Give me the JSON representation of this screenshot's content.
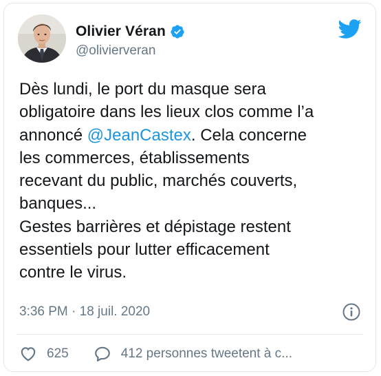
{
  "tweet": {
    "author": {
      "display_name": "Olivier Véran",
      "handle": "@olivierveran",
      "verified": true,
      "avatar_icon": "person-portrait-icon"
    },
    "brand_icon": "twitter-bird-icon",
    "text": {
      "part1": "Dès lundi, le port du masque sera\nobligatoire dans les lieux clos comme l’a\nannoncé ",
      "mention": "@JeanCastex",
      "part2": ". Cela concerne\nles commerces, établissements\nrecevant du public, marchés couverts,\nbanques...\nGestes barrières et dépistage restent\nessentiels pour lutter efficacement\ncontre le virus."
    },
    "timestamp": "3:36 PM · 18 juil. 2020",
    "info_icon": "info-icon",
    "likes": {
      "icon": "heart-icon",
      "count": "625"
    },
    "retweets": {
      "icon": "speech-bubble-icon",
      "label": "412 personnes tweetent à c..."
    }
  },
  "colors": {
    "text": "#14171a",
    "secondary": "#657786",
    "brand": "#1da1f2",
    "mention": "#1b95e0",
    "border": "#e1e8ed"
  }
}
